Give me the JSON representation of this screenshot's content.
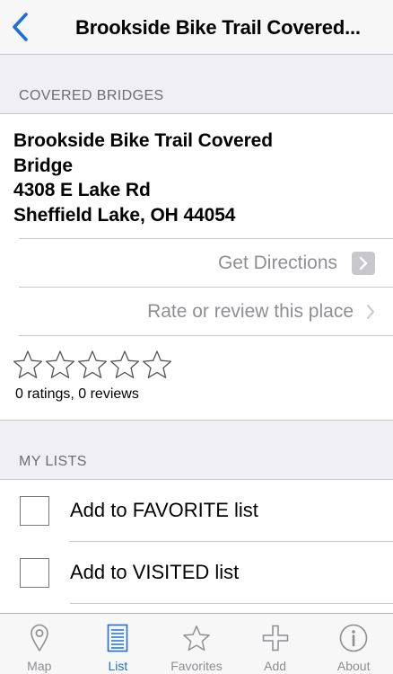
{
  "colors": {
    "accent": "#1d6fd6",
    "muted": "#8e8e93",
    "background": "#efeff4"
  },
  "nav": {
    "title": "Brookside Bike Trail Covered...",
    "back_icon": "chevron-left-icon"
  },
  "sections": {
    "covered": "COVERED BRIDGES",
    "lists": "MY LISTS"
  },
  "place": {
    "address_lines": [
      "Brookside Bike Trail Covered",
      "Bridge",
      "4308 E Lake Rd",
      "Sheffield Lake, OH 44054"
    ],
    "directions_label": "Get Directions",
    "review_label": "Rate or review this place",
    "rating": 0,
    "ratings_text": "0 ratings, 0 reviews"
  },
  "lists": {
    "items": [
      {
        "label": "Add to FAVORITE list",
        "checked": false
      },
      {
        "label": "Add to VISITED list",
        "checked": false
      }
    ]
  },
  "tabs": [
    {
      "label": "Map",
      "icon": "map-pin-icon",
      "active": false
    },
    {
      "label": "List",
      "icon": "list-icon",
      "active": true
    },
    {
      "label": "Favorites",
      "icon": "star-icon",
      "active": false
    },
    {
      "label": "Add",
      "icon": "plus-icon",
      "active": false
    },
    {
      "label": "About",
      "icon": "info-icon",
      "active": false
    }
  ]
}
